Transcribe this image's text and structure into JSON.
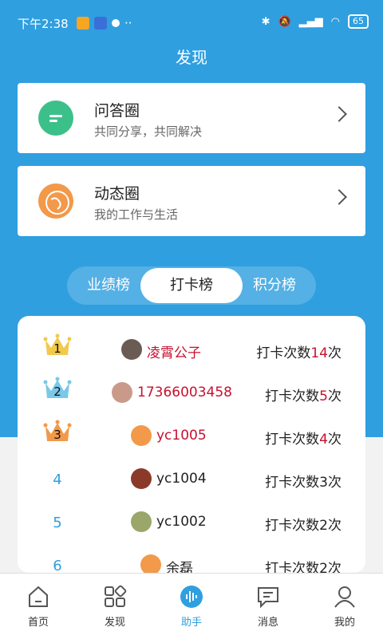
{
  "status": {
    "time": "下午2:38",
    "battery": "65"
  },
  "header": {
    "title": "发现"
  },
  "cards": [
    {
      "title": "问答圈",
      "subtitle": "共同分享，共同解决",
      "icon": "chat-icon"
    },
    {
      "title": "动态圈",
      "subtitle": "我的工作与生活",
      "icon": "globe-icon"
    }
  ],
  "tabs": [
    {
      "label": "业绩榜",
      "active": false
    },
    {
      "label": "打卡榜",
      "active": true
    },
    {
      "label": "积分榜",
      "active": false
    }
  ],
  "ranking": [
    {
      "rank": "1",
      "name": "凌霄公子",
      "count_prefix": "打卡次数",
      "count": "14",
      "count_suffix": "次",
      "highlight": true,
      "crown": "gold"
    },
    {
      "rank": "2",
      "name": "17366003458",
      "count_prefix": "打卡次数",
      "count": "5",
      "count_suffix": "次",
      "highlight": true,
      "crown": "silver"
    },
    {
      "rank": "3",
      "name": "yc1005",
      "count_prefix": "打卡次数",
      "count": "4",
      "count_suffix": "次",
      "highlight": true,
      "crown": "bronze"
    },
    {
      "rank": "4",
      "name": "yc1004",
      "count_prefix": "打卡次数",
      "count": "3",
      "count_suffix": "次",
      "highlight": false
    },
    {
      "rank": "5",
      "name": "yc1002",
      "count_prefix": "打卡次数",
      "count": "2",
      "count_suffix": "次",
      "highlight": false
    },
    {
      "rank": "6",
      "name": "余磊",
      "count_prefix": "打卡次数",
      "count": "2",
      "count_suffix": "次",
      "highlight": false
    }
  ],
  "nav": [
    {
      "label": "首页",
      "icon": "home-icon",
      "active": false
    },
    {
      "label": "发现",
      "icon": "grid-icon",
      "active": false
    },
    {
      "label": "助手",
      "icon": "voice-icon",
      "active": true
    },
    {
      "label": "消息",
      "icon": "message-icon",
      "active": false
    },
    {
      "label": "我的",
      "icon": "profile-icon",
      "active": false
    }
  ],
  "colors": {
    "primary": "#2f9fe0",
    "highlight": "#c8102e",
    "gold": "#f2c94c",
    "silver": "#7ac8e8",
    "bronze": "#f2994a"
  }
}
